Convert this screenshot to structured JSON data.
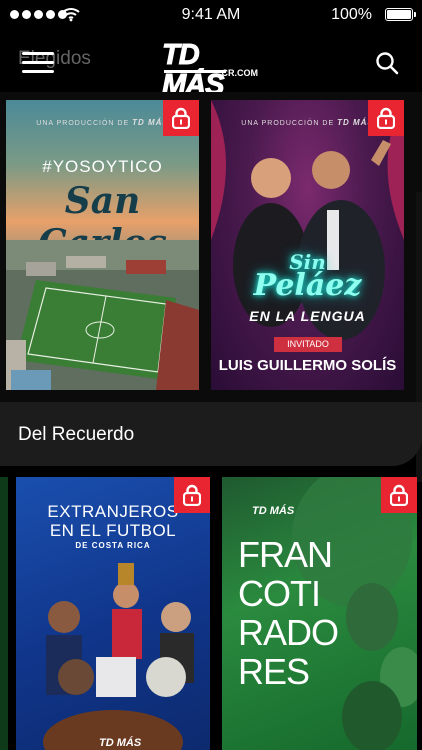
{
  "status": {
    "time": "9:41 AM",
    "battery": "100%"
  },
  "header": {
    "section_ghost": "Elegidos",
    "logo_main": "TD MÁS",
    "logo_sub": "CR.COM"
  },
  "cards_row1": [
    {
      "production": "UNA PRODUCCIÓN DE",
      "brand": "TD MÁS",
      "hashtag": "#YOSOYTICO",
      "title": "San Carlos",
      "locked": true
    },
    {
      "production": "UNA PRODUCCIÓN DE",
      "brand": "TD MÁS",
      "title_1": "Sin",
      "title_2": "Peláez",
      "subtitle": "EN LA LENGUA",
      "badge": "INVITADO",
      "guest": "LUIS GUILLERMO SOLÍS",
      "locked": true
    }
  ],
  "section": {
    "title": "Del Recuerdo"
  },
  "cards_row2": [
    {
      "title_1": "EXTRANJEROS",
      "title_2": "EN EL FUTBOL",
      "subtitle": "DE COSTA RICA",
      "brand": "TD MÁS",
      "locked": true
    },
    {
      "brand": "TD MÁS",
      "lines": [
        "FRAN",
        "COTI",
        "RADO",
        "RES"
      ],
      "locked": true
    }
  ],
  "colors": {
    "lock": "#e82530",
    "background": "#000000",
    "section_bg": "#1c1c1c"
  },
  "icons": {
    "menu": "hamburger-menu-icon",
    "search": "search-icon",
    "lock": "lock-icon"
  }
}
